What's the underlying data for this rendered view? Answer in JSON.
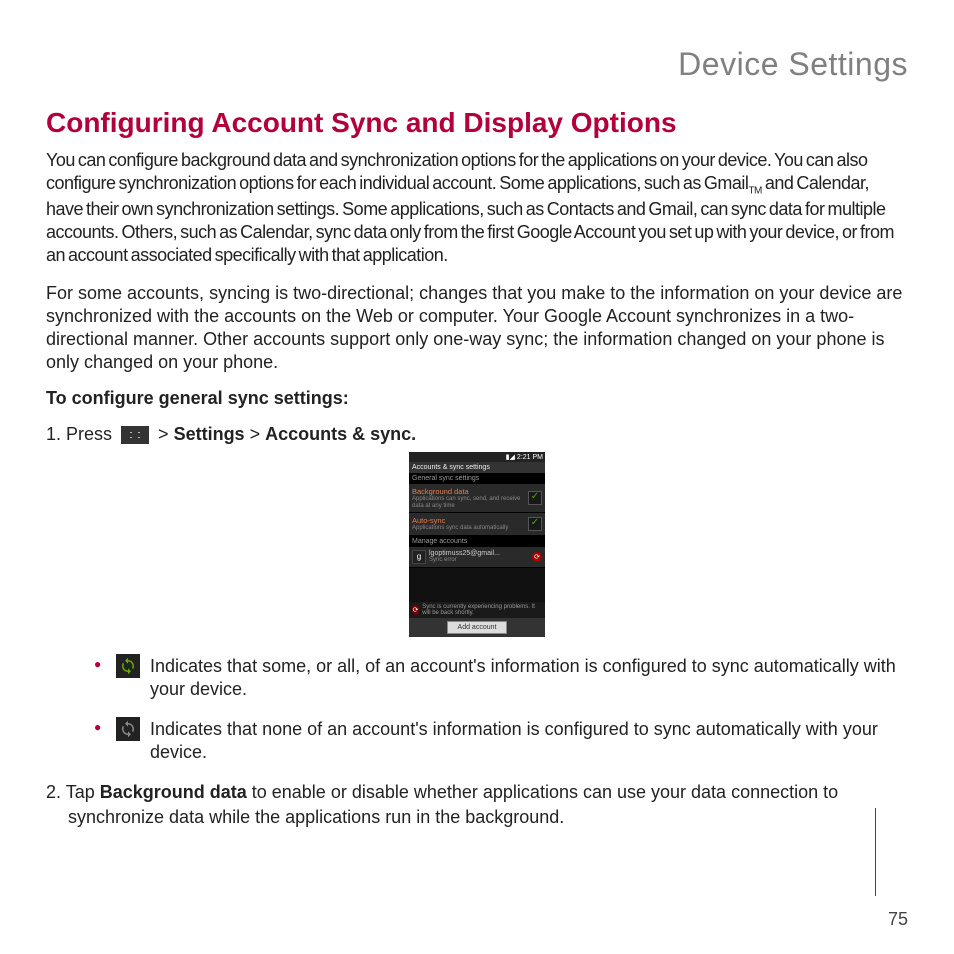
{
  "chapter": "Device Settings",
  "section_title": "Configuring Account Sync and Display Options",
  "para1_a": "You can configure background data and synchronization options for the applications on your device. You can also configure synchronization options for each individual account. Some applications, such as Gmail",
  "para1_tm": "TM",
  "para1_b": " and Calendar, have their own synchronization settings. Some applications, such as Contacts and Gmail, can sync data for multiple accounts. Others, such as Calendar, sync data only from the first Google Account you set up with your device, or from an account associated specifically with that application.",
  "para2": "For some accounts, syncing is two-directional; changes that you make to the information on your device are synchronized with the accounts on the Web or computer. Your Google Account synchronizes in a two-directional manner. Other accounts support only one-way sync; the information changed on your phone is only changed on your phone.",
  "subhead": "To configure general sync settings:",
  "step1_a": "1. Press ",
  "step1_b": "  > ",
  "step1_settings": "Settings",
  "step1_c": " > ",
  "step1_accounts": "Accounts & sync.",
  "phone": {
    "time": "2:21 PM",
    "title": "Accounts & sync settings",
    "group1": "General sync settings",
    "row1_title": "Background data",
    "row1_sub": "Applications can sync, send, and receive data at any time",
    "row2_title": "Auto-sync",
    "row2_sub": "Applications sync data automatically",
    "group2": "Manage accounts",
    "acct_email": "lgoptimuss25@gmail...",
    "acct_sub": "Sync error",
    "warn": "Sync is currently experiencing problems. It will be back shortly.",
    "add": "Add account"
  },
  "bullet1": " Indicates that some, or all, of an account's information is configured to sync automatically with your device.",
  "bullet2": " Indicates that none of an account's information is configured to sync automatically with your device.",
  "step2_a": "2. Tap ",
  "step2_label": "Background data",
  "step2_b": " to enable or disable whether applications can use your data connection to synchronize data while the applications run in the background.",
  "page_number": "75"
}
